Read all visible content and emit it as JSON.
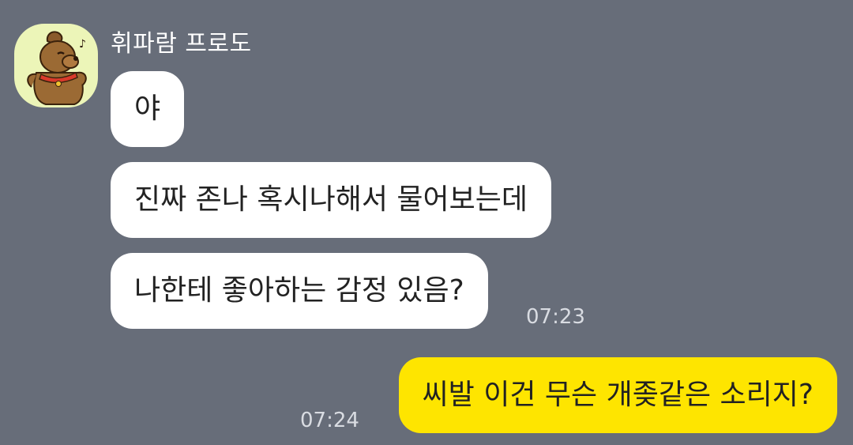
{
  "sender": {
    "name": "휘파람 프로도",
    "avatar_icon": "frodo-dog-character-icon"
  },
  "messages": [
    {
      "side": "left",
      "text": "야"
    },
    {
      "side": "left",
      "text": "진짜 존나 혹시나해서 물어보는데"
    },
    {
      "side": "left",
      "text": "나한테 좋아하는 감정 있음?",
      "time": "07:23"
    },
    {
      "side": "right",
      "text": "씨발 이건 무슨 개좆같은 소리지?",
      "time": "07:24"
    }
  ],
  "colors": {
    "background": "#676d79",
    "incoming_bubble": "#ffffff",
    "outgoing_bubble": "#fee500",
    "avatar_bg": "#ecf5b8"
  }
}
